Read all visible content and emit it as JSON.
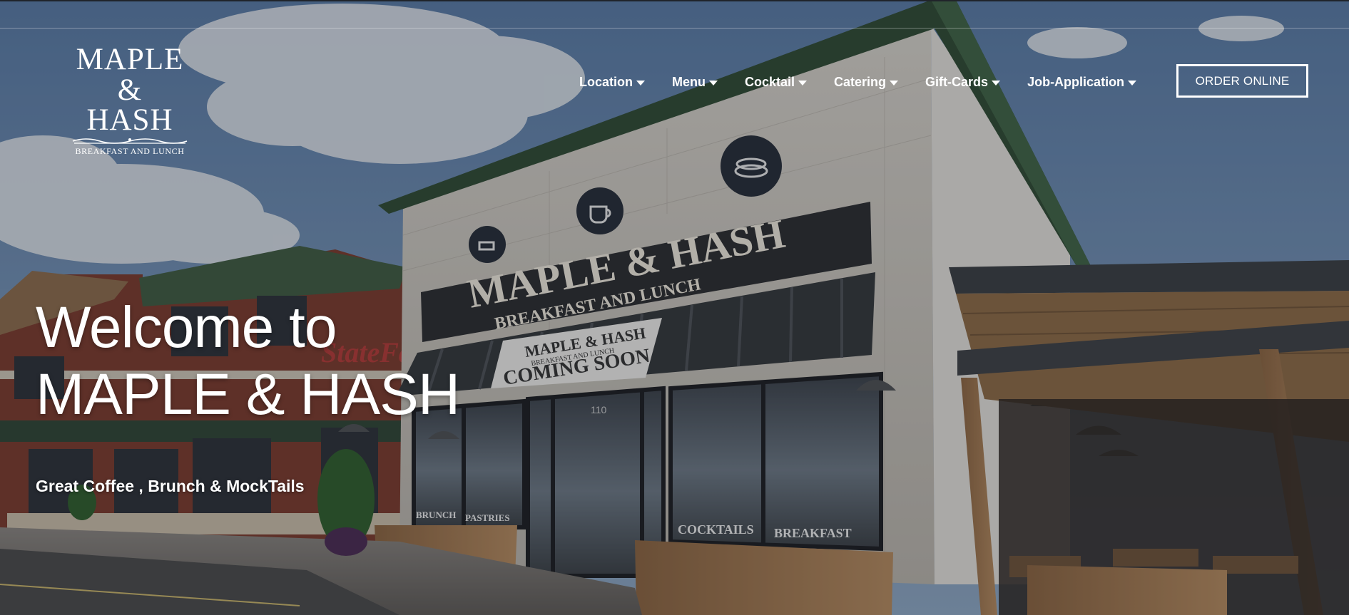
{
  "logo": {
    "line1": "MAPLE",
    "line2": "& HASH",
    "tagline": "BREAKFAST AND LUNCH"
  },
  "nav": {
    "items": [
      {
        "label": "Location"
      },
      {
        "label": "Menu"
      },
      {
        "label": "Cocktail"
      },
      {
        "label": "Catering"
      },
      {
        "label": "Gift-Cards"
      },
      {
        "label": "Job-Application"
      }
    ],
    "order_label": "ORDER ONLINE"
  },
  "hero": {
    "headline_line1": "Welcome to",
    "headline_line2": "MAPLE & HASH",
    "subheadline": "Great Coffee , Brunch & MockTails"
  },
  "storefront": {
    "sign_main": "MAPLE & HASH",
    "sign_sub": "BREAKFAST AND LUNCH",
    "banner_main": "MAPLE & HASH",
    "banner_sub": "BREAKFAST AND LUNCH",
    "banner_note": "COMING SOON",
    "window_brunch": "BRUNCH",
    "window_pastries": "PASTRIES",
    "window_cocktails": "COCKTAILS",
    "window_breakfast": "BREAKFAST",
    "neighbor_sign": "StateFa",
    "door_number": "110"
  },
  "colors": {
    "sky_top": "#5f7fa8",
    "sky_bottom": "#8fa9c6",
    "roof_green": "#2f4a32",
    "brick_white": "#c9c4bb",
    "brick_red": "#7a3528",
    "sign_dark": "#2a2b2e",
    "wood": "#9a7450"
  }
}
